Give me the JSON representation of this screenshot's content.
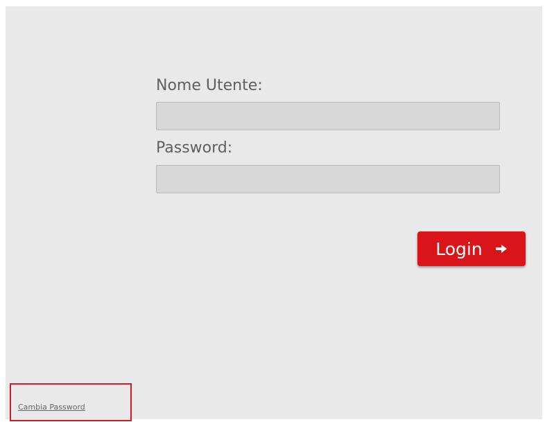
{
  "form": {
    "username_label": "Nome Utente:",
    "username_value": "",
    "password_label": "Password:",
    "password_value": "",
    "login_label": "Login",
    "login_icon": "arrow-right-icon"
  },
  "footer": {
    "change_password_label": "Cambia Password"
  },
  "colors": {
    "background": "#e9e9e9",
    "input_bg": "#d7d7d7",
    "button": "#d9151a",
    "highlight_box": "#d01b23"
  }
}
